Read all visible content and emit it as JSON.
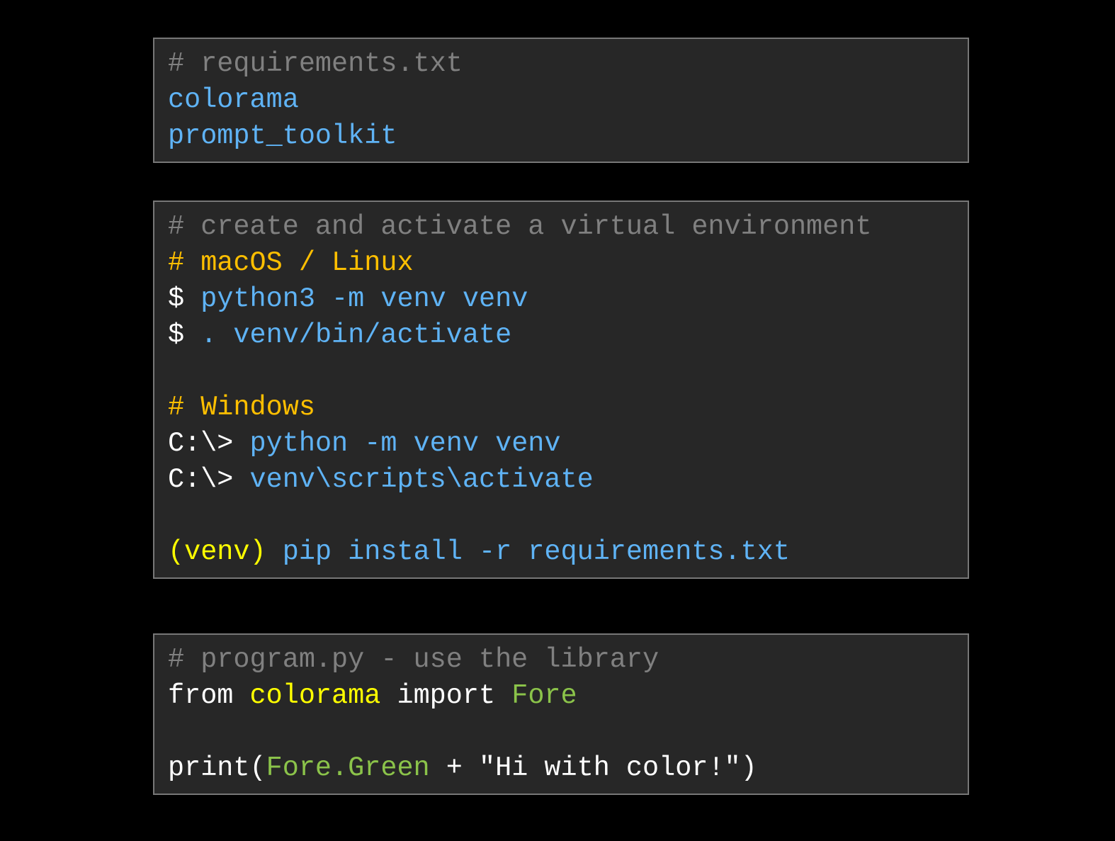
{
  "colors": {
    "comment": "#808080",
    "blue": "#5fb3f5",
    "orange": "#ffbf00",
    "white": "#ffffff",
    "yellow": "#ffff00",
    "green": "#8bc34a",
    "background": "#000000",
    "block_background": "#272727",
    "block_border": "#777777"
  },
  "blocks": [
    {
      "name": "requirements-block",
      "lines": [
        [
          {
            "text": "# requirements.txt",
            "color": "comment"
          }
        ],
        [
          {
            "text": "colorama",
            "color": "blue"
          }
        ],
        [
          {
            "text": "prompt_toolkit",
            "color": "blue"
          }
        ]
      ]
    },
    {
      "name": "venv-block",
      "lines": [
        [
          {
            "text": "# create and activate a virtual environment",
            "color": "comment"
          }
        ],
        [
          {
            "text": "# macOS / Linux",
            "color": "orange"
          }
        ],
        [
          {
            "text": "$ ",
            "color": "white"
          },
          {
            "text": "python3 -m venv venv",
            "color": "blue"
          }
        ],
        [
          {
            "text": "$ ",
            "color": "white"
          },
          {
            "text": ". venv/bin/activate",
            "color": "blue"
          }
        ],
        [],
        [
          {
            "text": "# Windows",
            "color": "orange"
          }
        ],
        [
          {
            "text": "C:\\> ",
            "color": "white"
          },
          {
            "text": "python -m venv venv",
            "color": "blue"
          }
        ],
        [
          {
            "text": "C:\\> ",
            "color": "white"
          },
          {
            "text": "venv\\scripts\\activate",
            "color": "blue"
          }
        ],
        [],
        [
          {
            "text": "(venv) ",
            "color": "yellow"
          },
          {
            "text": "pip install -r requirements.txt",
            "color": "blue"
          }
        ]
      ]
    },
    {
      "name": "program-block",
      "lines": [
        [
          {
            "text": "# program.py - use the library",
            "color": "comment"
          }
        ],
        [
          {
            "text": "from ",
            "color": "white"
          },
          {
            "text": "colorama",
            "color": "yellow"
          },
          {
            "text": " import ",
            "color": "white"
          },
          {
            "text": "Fore",
            "color": "green"
          }
        ],
        [],
        [
          {
            "text": "print(",
            "color": "white"
          },
          {
            "text": "Fore.Green",
            "color": "green"
          },
          {
            "text": " + \"Hi with color!\")",
            "color": "white"
          }
        ]
      ]
    }
  ]
}
